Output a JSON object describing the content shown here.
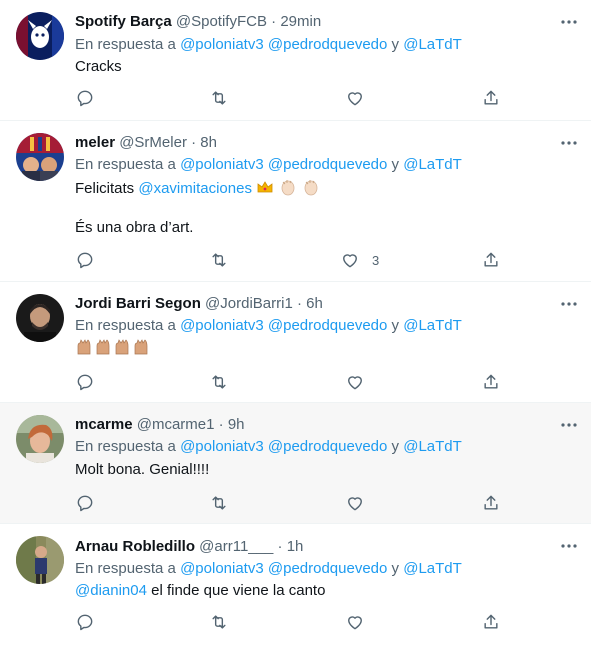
{
  "reply_prefix": "En respuesta a",
  "reply_joiner": "y",
  "tweets": [
    {
      "name": "Spotify Barça",
      "handle": "@SpotifyFCB",
      "dot": "·",
      "time": "29min",
      "mentions": [
        "@poloniatv3",
        "@pedrodquevedo",
        "@LaTdT"
      ],
      "text": "Cracks",
      "like_count": ""
    },
    {
      "name": "meler",
      "handle": "@SrMeler",
      "dot": "·",
      "time": "8h",
      "mentions": [
        "@poloniatv3",
        "@pedrodquevedo",
        "@LaTdT"
      ],
      "text_prefix": "Felicitats",
      "text_mention": "@xavimitaciones",
      "text_line2": "És una obra d’art.",
      "like_count": "3"
    },
    {
      "name": "Jordi Barri Segon",
      "handle": "@JordiBarri1",
      "dot": "·",
      "time": "6h",
      "mentions": [
        "@poloniatv3",
        "@pedrodquevedo",
        "@LaTdT"
      ],
      "like_count": ""
    },
    {
      "name": "mcarme",
      "handle": "@mcarme1",
      "dot": "·",
      "time": "9h",
      "mentions": [
        "@poloniatv3",
        "@pedrodquevedo",
        "@LaTdT"
      ],
      "text": "Molt bona. Genial!!!!",
      "like_count": ""
    },
    {
      "name": "Arnau Robledillo",
      "handle": "@arr11___",
      "dot": "·",
      "time": "1h",
      "mentions": [
        "@poloniatv3",
        "@pedrodquevedo",
        "@LaTdT"
      ],
      "text_mention": "@dianin04",
      "text_rest": "el finde que viene la canto",
      "like_count": ""
    }
  ],
  "colors": {
    "accent": "#1d9bf0",
    "muted": "#536471",
    "text": "#0f1419",
    "highlight_bg": "#f7f7f7",
    "divider": "#eff3f4"
  },
  "icons": [
    "more-icon",
    "reply-icon",
    "retweet-icon",
    "like-icon",
    "share-icon",
    "crown-emoji",
    "clap-emoji",
    "raised-hands-emoji"
  ]
}
